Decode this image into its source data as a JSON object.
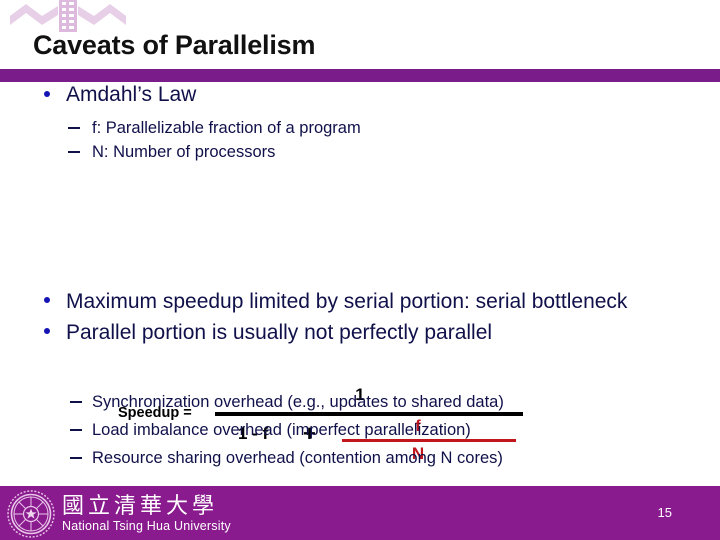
{
  "slide": {
    "title": "Caveats of Parallelism",
    "page_number": "15",
    "accent_purple": "#7a1d8a",
    "footer_purple": "#8a1b8e",
    "bullet_blue": "#1414b4",
    "text_navy": "#10104a",
    "formula_red": "#c0161c"
  },
  "amdahl": {
    "heading": "Amdahl’s Law",
    "sub_items": [
      {
        "text": "f: Parallelizable fraction of a program"
      },
      {
        "text": "N: Number of processors"
      }
    ]
  },
  "formula": {
    "label": "Speedup =",
    "numerator": "1",
    "denominator_left": "1 - f",
    "operator": "+",
    "fraction_numerator": "f",
    "fraction_denominator": "N"
  },
  "main_points": [
    {
      "text": "Maximum speedup limited by serial portion: serial bottleneck"
    },
    {
      "text": "Parallel portion is usually not perfectly parallel"
    }
  ],
  "overheads": [
    {
      "text": "Synchronization overhead (e.g., updates to shared data)"
    },
    {
      "text": "Load imbalance overhead (imperfect parallelization)"
    },
    {
      "text": "Resource sharing overhead (contention among N cores)"
    }
  ],
  "footer": {
    "university_cn": "國立清華大學",
    "university_en": "National Tsing Hua University"
  }
}
